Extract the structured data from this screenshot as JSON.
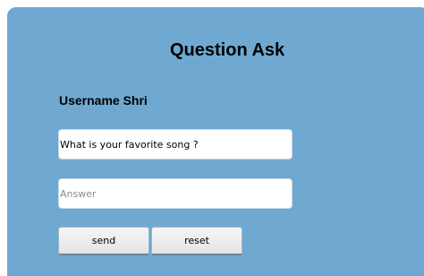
{
  "form": {
    "title": "Question Ask",
    "username_label": "Username Shri",
    "question_value": "What is your favorite song ?",
    "answer_value": "",
    "answer_placeholder": "Answer",
    "send_label": "send",
    "reset_label": "reset"
  },
  "colors": {
    "panel_background": "#6fa9d1"
  }
}
